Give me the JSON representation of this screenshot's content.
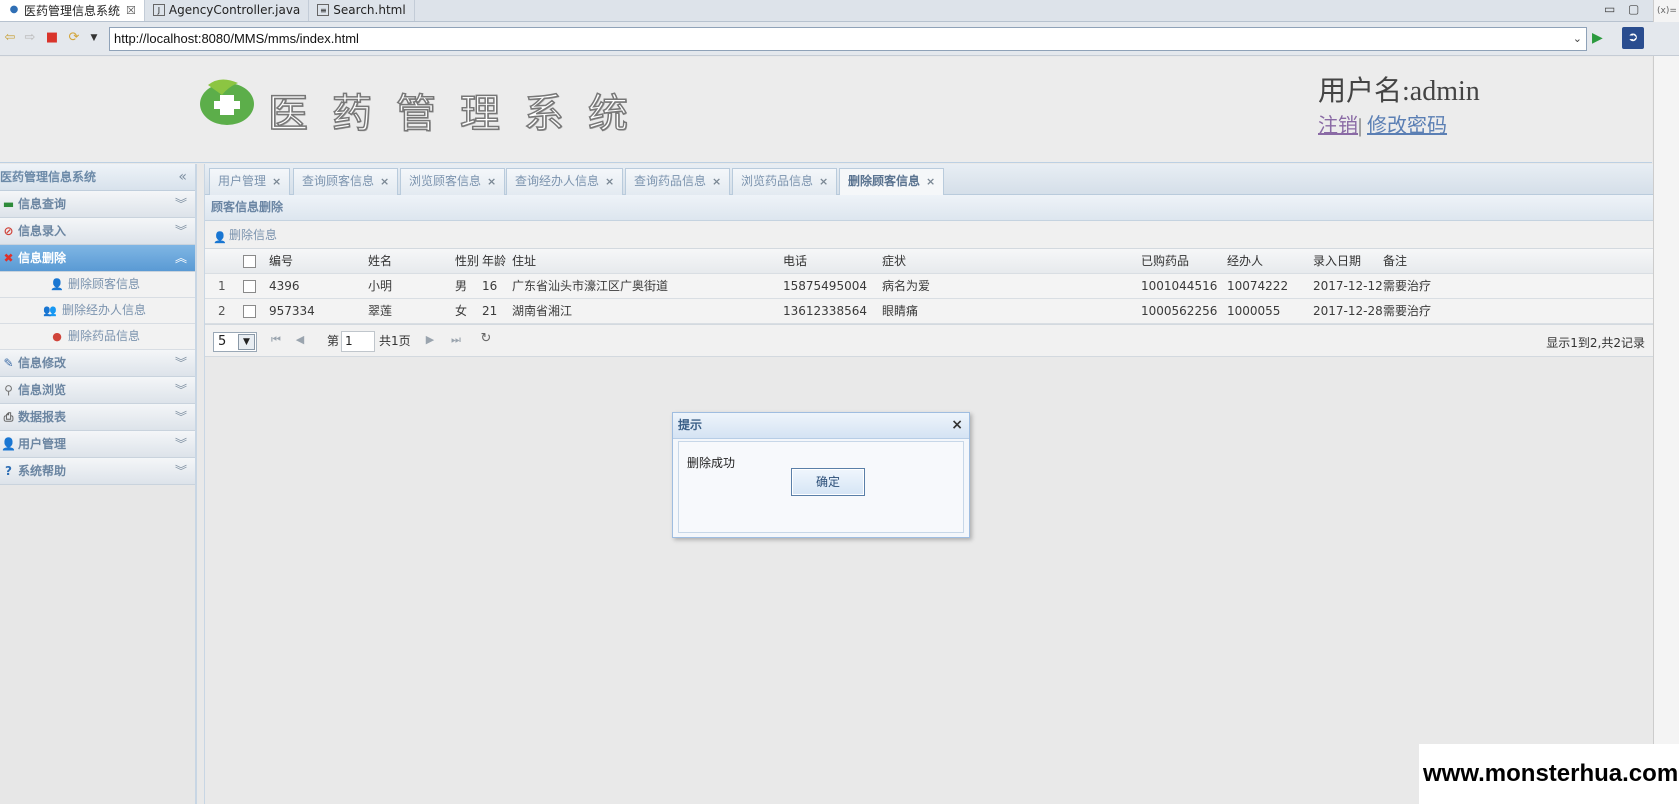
{
  "ide": {
    "tabs": [
      {
        "label": "医药管理信息系统",
        "icon": "globe-icon",
        "close": "☒",
        "active": true
      },
      {
        "label": "AgencyController.java",
        "icon": "java-file-icon",
        "active": false
      },
      {
        "label": "Search.html",
        "icon": "html-file-icon",
        "active": false
      }
    ],
    "side_label": "(x)="
  },
  "browser": {
    "url": "http://localhost:8080/MMS/mms/index.html"
  },
  "header": {
    "title": "医药管理系统",
    "user_label": "用户名:admin",
    "logout": "注销",
    "separator": "|",
    "change_password": "修改密码"
  },
  "sidebar": {
    "title": "医药管理信息系统",
    "collapse_glyph": "«",
    "sections": [
      {
        "label": "信息查询",
        "icon": "search-list-icon",
        "active": false
      },
      {
        "label": "信息录入",
        "icon": "input-icon",
        "active": false
      },
      {
        "label": "信息删除",
        "icon": "delete-icon",
        "active": true
      },
      {
        "label": "信息修改",
        "icon": "pencil-icon",
        "active": false
      },
      {
        "label": "信息浏览",
        "icon": "magnifier-icon",
        "active": false
      },
      {
        "label": "数据报表",
        "icon": "printer-icon",
        "active": false
      },
      {
        "label": "用户管理",
        "icon": "user-icon",
        "active": false
      },
      {
        "label": "系统帮助",
        "icon": "help-icon",
        "active": false
      }
    ],
    "delete_items": [
      {
        "label": "删除顾客信息",
        "icon": "customer-icon"
      },
      {
        "label": "删除经办人信息",
        "icon": "agent-icon"
      },
      {
        "label": "删除药品信息",
        "icon": "pill-icon"
      }
    ]
  },
  "main": {
    "tabs": [
      {
        "label": "用户管理"
      },
      {
        "label": "查询顾客信息"
      },
      {
        "label": "浏览顾客信息"
      },
      {
        "label": "查询经办人信息"
      },
      {
        "label": "查询药品信息"
      },
      {
        "label": "浏览药品信息"
      },
      {
        "label": "删除顾客信息",
        "active": true
      }
    ],
    "tab_close": "×",
    "grid_title": "顾客信息删除",
    "toolbar_delete": "删除信息",
    "columns": [
      "编号",
      "姓名",
      "性别",
      "年龄",
      "住址",
      "电话",
      "症状",
      "已购药品",
      "经办人",
      "录入日期",
      "备注"
    ],
    "rows": [
      {
        "num": "1",
        "cells": [
          "4396",
          "小明",
          "男",
          "16",
          "广东省汕头市濠江区广奥街道",
          "15875495004",
          "病名为爱",
          "1001044516",
          "10074222",
          "2017-12-12",
          "需要治疗"
        ]
      },
      {
        "num": "2",
        "cells": [
          "957334",
          "翠莲",
          "女",
          "21",
          "湖南省湘江",
          "13612338564",
          "眼睛痛",
          "1000562256",
          "1000055",
          "2017-12-28",
          "需要治疗"
        ]
      }
    ],
    "pager": {
      "page_size": "5",
      "page_prefix": "第",
      "page_value": "1",
      "page_suffix": "共1页",
      "info": "显示1到2,共2记录"
    }
  },
  "dialog": {
    "title": "提示",
    "close": "×",
    "message": "删除成功",
    "ok": "确定"
  },
  "watermark": "www.monsterhua.com"
}
